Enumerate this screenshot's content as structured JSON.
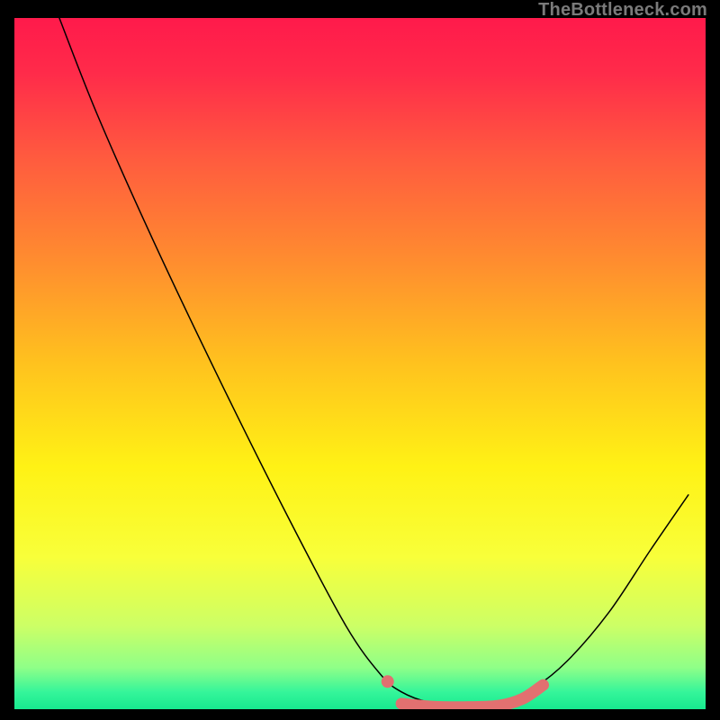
{
  "watermark": "TheBottleneck.com",
  "chart_data": {
    "type": "line",
    "title": "",
    "xlabel": "",
    "ylabel": "",
    "xlim": [
      0,
      100
    ],
    "ylim": [
      0,
      100
    ],
    "grid": false,
    "legend": false,
    "background_gradient": {
      "stops": [
        {
          "offset": 0.0,
          "color": "#ff1a4b"
        },
        {
          "offset": 0.08,
          "color": "#ff2b4a"
        },
        {
          "offset": 0.2,
          "color": "#ff5a3f"
        },
        {
          "offset": 0.35,
          "color": "#ff8c2f"
        },
        {
          "offset": 0.5,
          "color": "#ffc21e"
        },
        {
          "offset": 0.65,
          "color": "#fff215"
        },
        {
          "offset": 0.78,
          "color": "#f8ff3a"
        },
        {
          "offset": 0.88,
          "color": "#ccff66"
        },
        {
          "offset": 0.94,
          "color": "#8fff88"
        },
        {
          "offset": 0.975,
          "color": "#35f59a"
        },
        {
          "offset": 1.0,
          "color": "#17e98f"
        }
      ]
    },
    "series": [
      {
        "name": "bottleneck-curve",
        "type": "curve",
        "color": "#000000",
        "width": 1.5,
        "points": [
          {
            "x": 6.5,
            "y": 100.0
          },
          {
            "x": 12.0,
            "y": 86.0
          },
          {
            "x": 20.0,
            "y": 68.0
          },
          {
            "x": 30.0,
            "y": 47.0
          },
          {
            "x": 40.0,
            "y": 27.0
          },
          {
            "x": 48.0,
            "y": 12.0
          },
          {
            "x": 53.0,
            "y": 5.0
          },
          {
            "x": 56.0,
            "y": 2.5
          },
          {
            "x": 60.0,
            "y": 1.0
          },
          {
            "x": 65.0,
            "y": 0.5
          },
          {
            "x": 70.0,
            "y": 1.0
          },
          {
            "x": 75.0,
            "y": 3.0
          },
          {
            "x": 80.0,
            "y": 7.0
          },
          {
            "x": 86.0,
            "y": 14.0
          },
          {
            "x": 92.0,
            "y": 23.0
          },
          {
            "x": 97.5,
            "y": 31.0
          }
        ]
      },
      {
        "name": "highlight-dot",
        "type": "dot",
        "color": "#e27070",
        "radius": 7,
        "points": [
          {
            "x": 54.0,
            "y": 4.0
          }
        ]
      },
      {
        "name": "highlight-band",
        "type": "thick-curve",
        "color": "#e27070",
        "width": 13,
        "points": [
          {
            "x": 56.0,
            "y": 0.8
          },
          {
            "x": 60.0,
            "y": 0.4
          },
          {
            "x": 65.0,
            "y": 0.3
          },
          {
            "x": 70.0,
            "y": 0.5
          },
          {
            "x": 73.5,
            "y": 1.5
          },
          {
            "x": 76.5,
            "y": 3.5
          }
        ]
      }
    ]
  }
}
